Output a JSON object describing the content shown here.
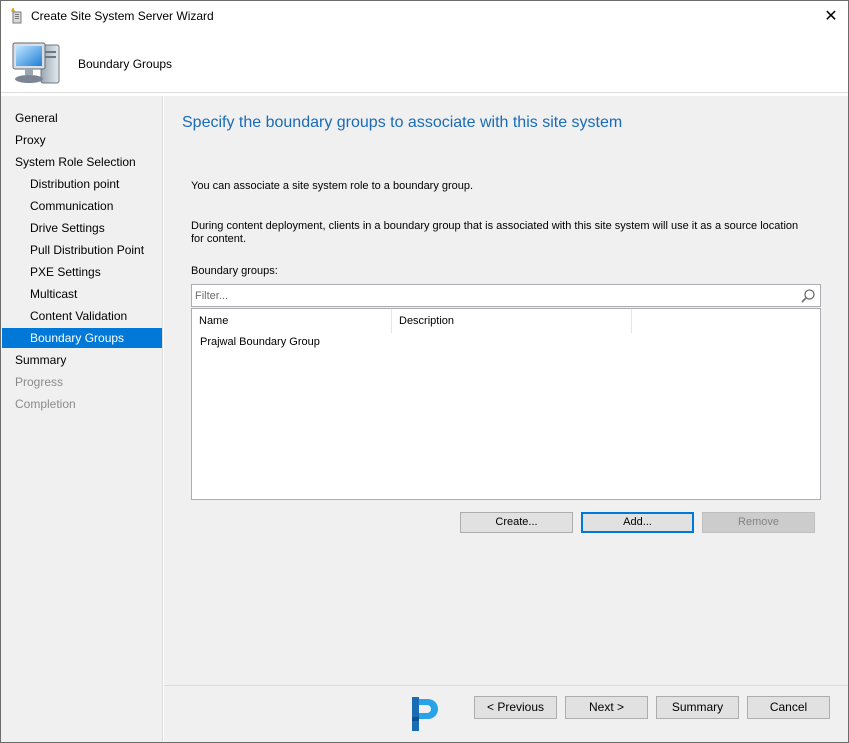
{
  "window": {
    "title": "Create Site System Server Wizard",
    "close_glyph": "✕"
  },
  "header": {
    "title": "Boundary Groups",
    "icon": "computer-monitor-icon"
  },
  "nav": {
    "items": [
      {
        "label": "General",
        "level": 1,
        "state": "normal"
      },
      {
        "label": "Proxy",
        "level": 1,
        "state": "normal"
      },
      {
        "label": "System Role Selection",
        "level": 1,
        "state": "normal"
      },
      {
        "label": "Distribution point",
        "level": 2,
        "state": "normal"
      },
      {
        "label": "Communication",
        "level": 2,
        "state": "normal"
      },
      {
        "label": "Drive Settings",
        "level": 2,
        "state": "normal"
      },
      {
        "label": "Pull Distribution Point",
        "level": 2,
        "state": "normal"
      },
      {
        "label": "PXE Settings",
        "level": 2,
        "state": "normal"
      },
      {
        "label": "Multicast",
        "level": 2,
        "state": "normal"
      },
      {
        "label": "Content Validation",
        "level": 2,
        "state": "normal"
      },
      {
        "label": "Boundary Groups",
        "level": 2,
        "state": "selected"
      },
      {
        "label": "Summary",
        "level": 1,
        "state": "normal"
      },
      {
        "label": "Progress",
        "level": 1,
        "state": "disabled"
      },
      {
        "label": "Completion",
        "level": 1,
        "state": "disabled"
      }
    ]
  },
  "main": {
    "heading": "Specify the boundary groups to associate with this site system",
    "para1": "You can associate a site system role to a boundary group.",
    "para2": "During content deployment, clients in a boundary group that is associated with this site system will use it as a source location for content.",
    "list_label": "Boundary groups:",
    "filter": {
      "placeholder": "Filter...",
      "value": ""
    },
    "columns": {
      "name": "Name",
      "description": "Description"
    },
    "rows": [
      {
        "name": "Prajwal Boundary Group",
        "description": ""
      }
    ],
    "buttons": {
      "create": "Create...",
      "add": "Add...",
      "remove": "Remove"
    }
  },
  "footer": {
    "previous": "< Previous",
    "next": "Next >",
    "summary": "Summary",
    "cancel": "Cancel"
  },
  "colors": {
    "accent": "#0078d7",
    "heading": "#1a6bb5",
    "panel": "#f0f0f0"
  }
}
